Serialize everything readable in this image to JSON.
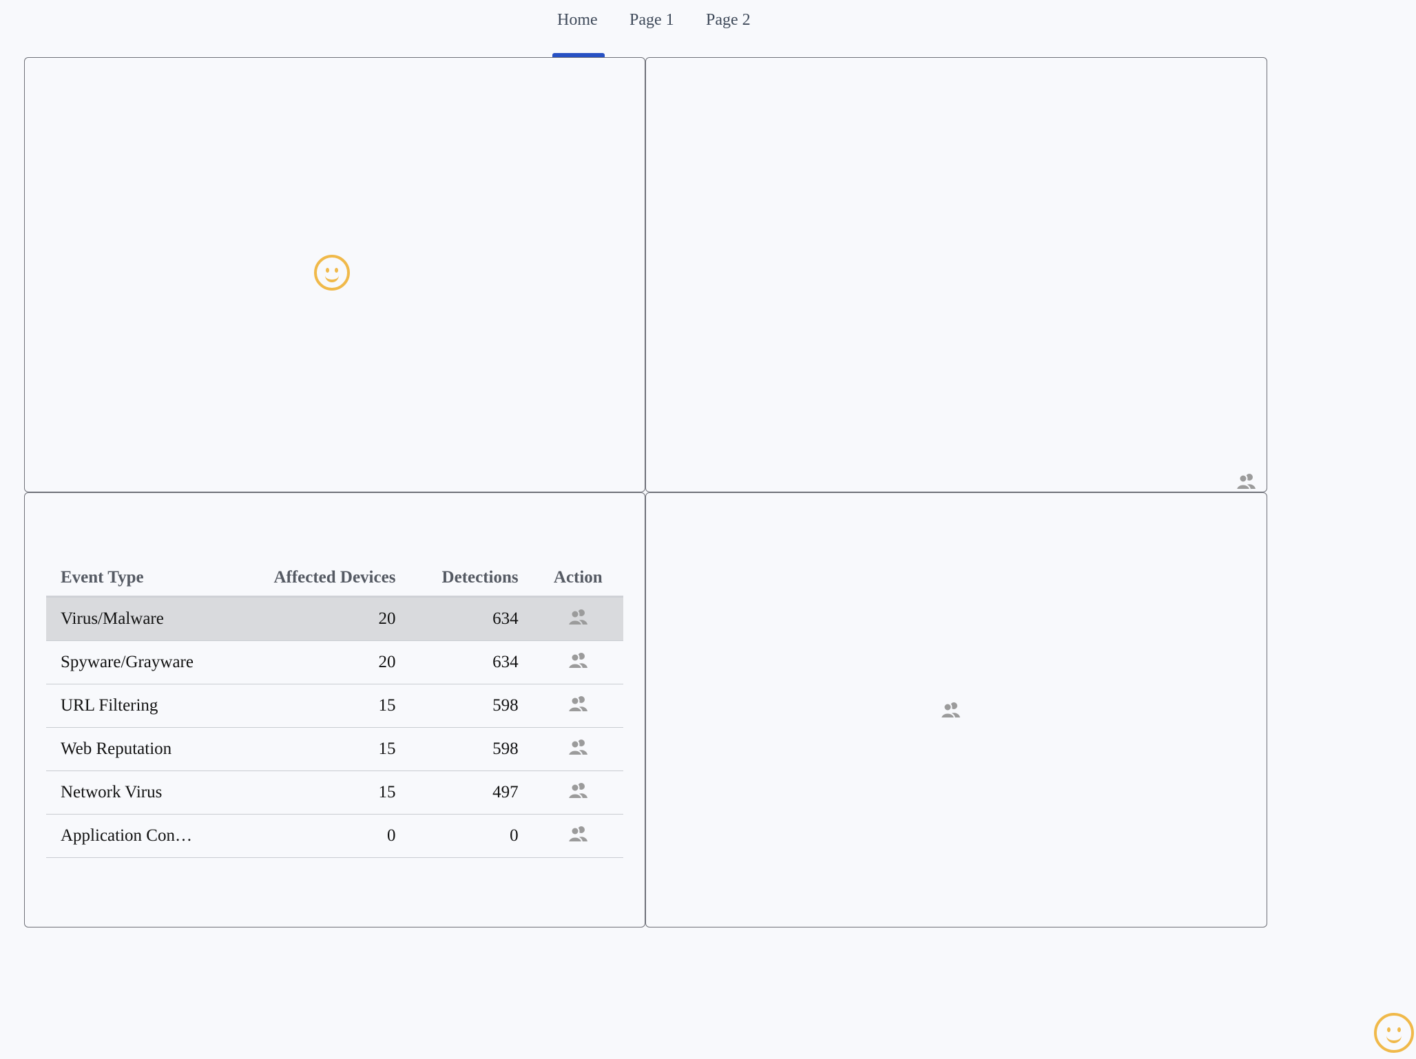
{
  "nav": {
    "tabs": [
      {
        "label": "Home",
        "active": true
      },
      {
        "label": "Page 1",
        "active": false
      },
      {
        "label": "Page 2",
        "active": false
      }
    ],
    "active_color": "#2751c3"
  },
  "table": {
    "headers": {
      "event_type": "Event Type",
      "affected_devices": "Affected Devices",
      "detections": "Detections",
      "action": "Action"
    },
    "rows": [
      {
        "event_type": "Virus/Malware",
        "affected_devices": "20",
        "detections": "634",
        "action_icon": "users-icon",
        "selected": true
      },
      {
        "event_type": "Spyware/Grayware",
        "affected_devices": "20",
        "detections": "634",
        "action_icon": "users-icon"
      },
      {
        "event_type": "URL Filtering",
        "affected_devices": "15",
        "detections": "598",
        "action_icon": "users-icon"
      },
      {
        "event_type": "Web Reputation",
        "affected_devices": "15",
        "detections": "598",
        "action_icon": "users-icon"
      },
      {
        "event_type": "Network Virus",
        "affected_devices": "15",
        "detections": "497",
        "action_icon": "users-icon"
      },
      {
        "event_type": "Application Con…",
        "affected_devices": "0",
        "detections": "0",
        "action_icon": "users-icon"
      }
    ]
  },
  "icons": {
    "smiley": "smiley-icon",
    "users": "users-icon"
  },
  "colors": {
    "smiley": "#f0b94a",
    "icon_gray": "#9b9b9b"
  }
}
